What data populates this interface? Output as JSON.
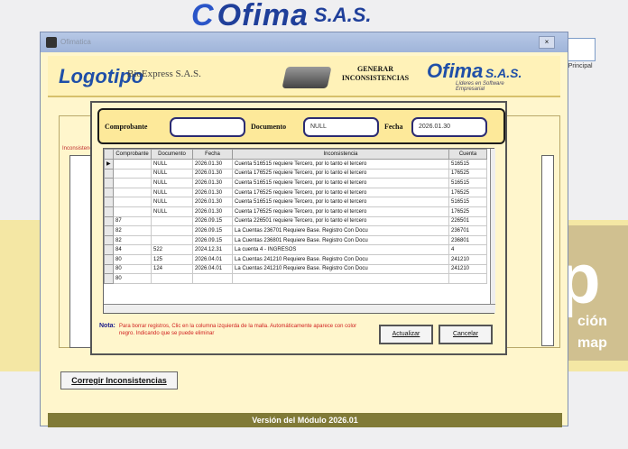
{
  "background": {
    "brand_name": "Ofima",
    "brand_suffix": "S.A.S.",
    "promo_big": "p",
    "promo_line1": "ción",
    "promo_line2": "map",
    "toolbar_icon_label": "de Principal"
  },
  "window": {
    "title": "Ofimatica",
    "close_label": "×",
    "logo_text": "Logotipo",
    "company": "BioExpress S.A.S.",
    "generate_title": "GENERAR INCONSISTENCIAS",
    "ofima_name": "Ofima",
    "ofima_sas": "S.A.S.",
    "ofima_tagline": "Líderes en Software Empresarial",
    "under_label": "Inconsistencias",
    "fix_button": "Corregir Inconsistencias",
    "footer": "Versión del Módulo 2026.01"
  },
  "dialog": {
    "labels": {
      "comprobante": "Comprobante",
      "documento": "Documento",
      "fecha": "Fecha"
    },
    "values": {
      "comprobante": "",
      "documento": "NULL",
      "fecha": "2026.01.30"
    },
    "columns": [
      "",
      "Comprobante",
      "Documento",
      "Fecha",
      "Inconsistencia",
      "Cuenta"
    ],
    "rows": [
      [
        "▶",
        "",
        "NULL",
        "2026.01.30",
        "Cuenta 516515 requiere Tercero, por lo tanto el tercero",
        "516515"
      ],
      [
        "",
        "",
        "NULL",
        "2026.01.30",
        "Cuenta 176525 requiere Tercero, por lo tanto el tercero",
        "176525"
      ],
      [
        "",
        "",
        "NULL",
        "2026.01.30",
        "Cuenta 516515 requiere Tercero, por lo tanto el tercero",
        "516515"
      ],
      [
        "",
        "",
        "NULL",
        "2026.01.30",
        "Cuenta 176525 requiere Tercero, por lo tanto el tercero",
        "176525"
      ],
      [
        "",
        "",
        "NULL",
        "2026.01.30",
        "Cuenta 516515 requiere Tercero, por lo tanto el tercero",
        "516515"
      ],
      [
        "",
        "",
        "NULL",
        "2026.01.30",
        "Cuenta 176525 requiere Tercero, por lo tanto el tercero",
        "176525"
      ],
      [
        "",
        "87",
        "",
        "2026.09.15",
        "Cuenta 226501 requiere Tercero, por lo tanto el tercero",
        "226501"
      ],
      [
        "",
        "82",
        "",
        "2026.09.15",
        "La Cuentas 236701 Requiere Base. Registro Con Docu",
        "236701"
      ],
      [
        "",
        "82",
        "",
        "2026.09.15",
        "La Cuentas 236801 Requiere Base. Registro Con Docu",
        "236801"
      ],
      [
        "",
        "84",
        "522",
        "2024.12.31",
        "La cuenta 4             - INGRESOS",
        "4"
      ],
      [
        "",
        "80",
        "125",
        "2026.04.01",
        "La Cuentas 241210 Requiere Base. Registro Con Docu",
        "241210"
      ],
      [
        "",
        "80",
        "124",
        "2026.04.01",
        "La Cuentas 241210 Requiere Base. Registro Con Docu",
        "241210"
      ],
      [
        "",
        "80",
        "",
        "",
        "",
        ""
      ]
    ],
    "nota_label": "Nota:",
    "nota_text": "Para borrar registros, Clic en la columna izquierda de la malla. Automáticamente aparece con color negro. Indicando que se puede eliminar",
    "btn_actualizar": "Actualizar",
    "btn_cancelar": "Cancelar"
  }
}
